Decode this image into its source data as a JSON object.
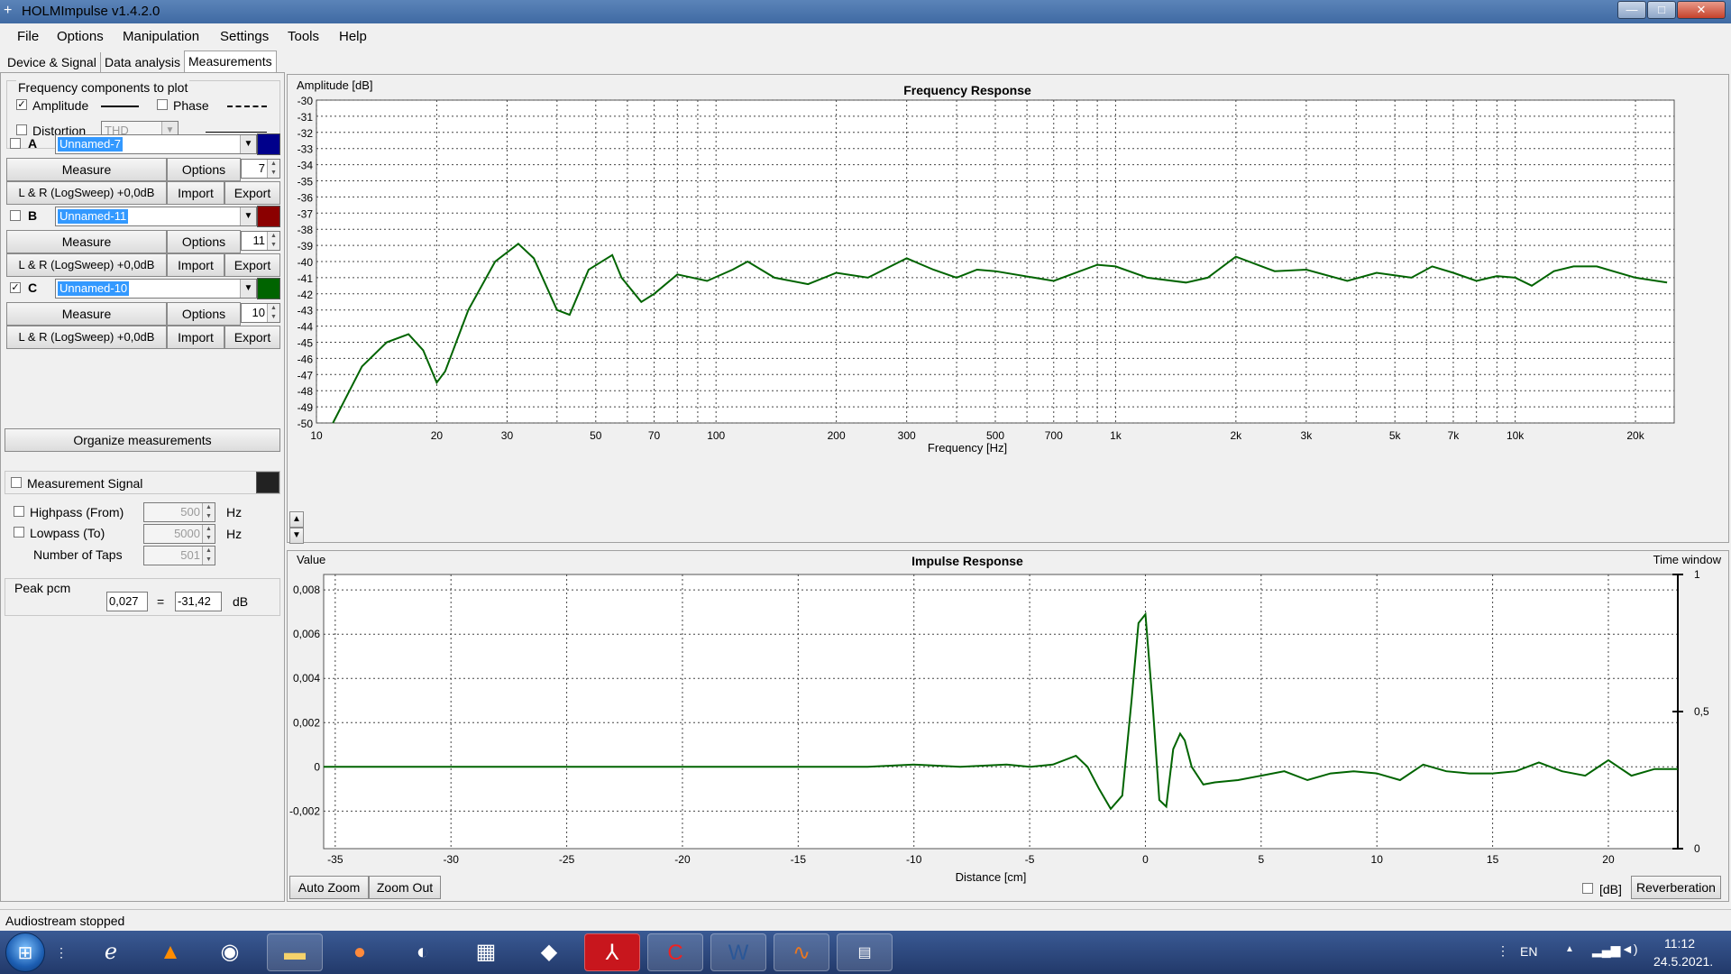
{
  "window": {
    "title": "HOLMImpulse  v1.4.2.0",
    "app_icon": "plus-icon",
    "min": "—",
    "max": "□",
    "close": "✕"
  },
  "menu": [
    "File",
    "Options",
    "Manipulation",
    "Settings",
    "Tools",
    "Help"
  ],
  "tabs": [
    "Device & Signal",
    "Data analysis",
    "Measurements"
  ],
  "freq_components": {
    "group_label": "Frequency components to plot",
    "amplitude_label": "Amplitude",
    "amplitude_checked": "✓",
    "phase_label": "Phase",
    "distortion_label": "Distortion",
    "distortion_mode": "THD"
  },
  "measurements": [
    {
      "letter": "A",
      "name": "Unnamed-7",
      "color": "#00008b",
      "checked": "",
      "measure": "Measure",
      "options": "Options",
      "count": "7",
      "signal": "L & R (LogSweep) +0,0dB",
      "import": "Import",
      "export": "Export"
    },
    {
      "letter": "B",
      "name": "Unnamed-11",
      "color": "#8b0000",
      "checked": "",
      "measure": "Measure",
      "options": "Options",
      "count": "11",
      "signal": "L & R (LogSweep) +0,0dB",
      "import": "Import",
      "export": "Export"
    },
    {
      "letter": "C",
      "name": "Unnamed-10",
      "color": "#006400",
      "checked": "✓",
      "measure": "Measure",
      "options": "Options",
      "count": "10",
      "signal": "L & R (LogSweep) +0,0dB",
      "import": "Import",
      "export": "Export"
    }
  ],
  "organize_label": "Organize measurements",
  "signal": {
    "measurement_signal_label": "Measurement Signal",
    "signal_color": "#222222",
    "highpass_label": "Highpass (From)",
    "highpass_value": "500",
    "lowpass_label": "Lowpass (To)",
    "lowpass_value": "5000",
    "hz": "Hz",
    "taps_label": "Number of Taps",
    "taps_value": "501"
  },
  "peak": {
    "label": "Peak pcm",
    "value": "0,027",
    "eq": "=",
    "db_value": "-31,42",
    "unit": "dB"
  },
  "freq_chart": {
    "title": "Frequency Response",
    "ylabel": "Amplitude [dB]",
    "xlabel": "Frequency [Hz]",
    "scroll_up": "▲",
    "scroll_down": "▼"
  },
  "imp_chart": {
    "title": "Impulse Response",
    "ylabel": "Value",
    "xlabel": "Distance [cm]",
    "time_window_label": "Time window",
    "auto_zoom": "Auto Zoom",
    "zoom_out": "Zoom Out",
    "db_label": "[dB]",
    "reverb": "Reverberation"
  },
  "chart_data": [
    {
      "type": "line",
      "title": "Frequency Response",
      "xlabel": "Frequency [Hz]",
      "ylabel": "Amplitude [dB]",
      "xscale": "log",
      "xlim": [
        10,
        25000
      ],
      "ylim": [
        -50,
        -30
      ],
      "grid": true,
      "x_ticks": [
        10,
        20,
        30,
        50,
        70,
        100,
        200,
        300,
        500,
        700,
        1000,
        2000,
        3000,
        5000,
        7000,
        10000,
        20000
      ],
      "x_tick_labels": [
        "10",
        "20",
        "30",
        "50",
        "70",
        "100",
        "200",
        "300",
        "500",
        "700",
        "1k",
        "2k",
        "3k",
        "5k",
        "7k",
        "10k",
        "20k"
      ],
      "y_ticks": [
        -30,
        -31,
        -32,
        -33,
        -34,
        -35,
        -36,
        -37,
        -38,
        -39,
        -40,
        -41,
        -42,
        -43,
        -44,
        -45,
        -46,
        -47,
        -48,
        -49,
        -50
      ],
      "series": [
        {
          "color": "#006400",
          "x": [
            11,
            13,
            15,
            17,
            18.5,
            20,
            21,
            24,
            28,
            32,
            35,
            40,
            43,
            48,
            55,
            58,
            65,
            70,
            80,
            95,
            110,
            120,
            140,
            170,
            200,
            240,
            300,
            350,
            400,
            450,
            500,
            700,
            900,
            1000,
            1200,
            1500,
            1700,
            2000,
            2500,
            3000,
            3800,
            4500,
            5500,
            6200,
            7000,
            8000,
            9000,
            10000,
            11000,
            12500,
            14000,
            16000,
            20000,
            24000
          ],
          "y": [
            -50,
            -46.5,
            -45,
            -44.5,
            -45.5,
            -47.5,
            -46.8,
            -43,
            -40,
            -38.9,
            -39.8,
            -43,
            -43.3,
            -40.5,
            -39.6,
            -41,
            -42.5,
            -42,
            -40.8,
            -41.2,
            -40.5,
            -40,
            -41,
            -41.4,
            -40.7,
            -41,
            -39.8,
            -40.5,
            -41,
            -40.5,
            -40.6,
            -41.2,
            -40.2,
            -40.3,
            -41,
            -41.3,
            -41,
            -39.7,
            -40.6,
            -40.5,
            -41.2,
            -40.7,
            -41,
            -40.3,
            -40.7,
            -41.2,
            -40.9,
            -41,
            -41.5,
            -40.6,
            -40.3,
            -40.3,
            -41,
            -41.3
          ]
        }
      ]
    },
    {
      "type": "line",
      "title": "Impulse Response",
      "xlabel": "Distance [cm]",
      "ylabel": "Value",
      "xlim": [
        -35.5,
        23
      ],
      "ylim": [
        -0.0037,
        0.0087
      ],
      "grid": true,
      "x_ticks": [
        -35,
        -30,
        -25,
        -20,
        -15,
        -10,
        -5,
        0,
        5,
        10,
        15,
        20
      ],
      "y_ticks": [
        0.008,
        0.006,
        0.004,
        0.002,
        0,
        -0.002
      ],
      "y_tick_labels": [
        "0,008",
        "0,006",
        "0,004",
        "0,002",
        "0",
        "-0,002"
      ],
      "y2_ticks": [
        1,
        0.5,
        0
      ],
      "y2_tick_labels": [
        "1",
        "0,5",
        "0"
      ],
      "series": [
        {
          "color": "#006400",
          "x": [
            -35.5,
            -12,
            -10,
            -8,
            -6,
            -5,
            -4,
            -3,
            -2.5,
            -2,
            -1.5,
            -1,
            -0.6,
            -0.3,
            0,
            0.3,
            0.6,
            0.9,
            1.2,
            1.5,
            1.7,
            2,
            2.5,
            3,
            4,
            5,
            6,
            7,
            8,
            9,
            10,
            11,
            12,
            13,
            14,
            15,
            16,
            17,
            18,
            19,
            20,
            21,
            22,
            23
          ],
          "y": [
            0,
            0,
            0.0001,
            0,
            0.0001,
            0,
            0.0001,
            0.0005,
            0,
            -0.001,
            -0.0019,
            -0.0013,
            0.003,
            0.0065,
            0.0069,
            0.003,
            -0.0015,
            -0.0018,
            0.0008,
            0.0015,
            0.0012,
            0,
            -0.0008,
            -0.0007,
            -0.0006,
            -0.0004,
            -0.0002,
            -0.0006,
            -0.0003,
            -0.0002,
            -0.0003,
            -0.0006,
            0.0001,
            -0.0002,
            -0.0003,
            -0.0003,
            -0.0002,
            0.0002,
            -0.0002,
            -0.0004,
            0.0003,
            -0.0004,
            -0.0001,
            -0.0001
          ]
        }
      ]
    }
  ],
  "status": "Audiostream stopped",
  "taskbar": {
    "items": [
      "grip-icon",
      "ie-icon",
      "vlc-icon",
      "chrome-icon",
      "explorer-icon",
      "firefox-icon",
      "paint-icon",
      "calculator-icon",
      "app-icon",
      "acrobat-icon",
      "ccleaner-icon",
      "word-icon",
      "matlab-icon",
      "holmimpulse-icon"
    ],
    "lang": "EN",
    "time": "11:12",
    "date": "24.5.2021."
  }
}
